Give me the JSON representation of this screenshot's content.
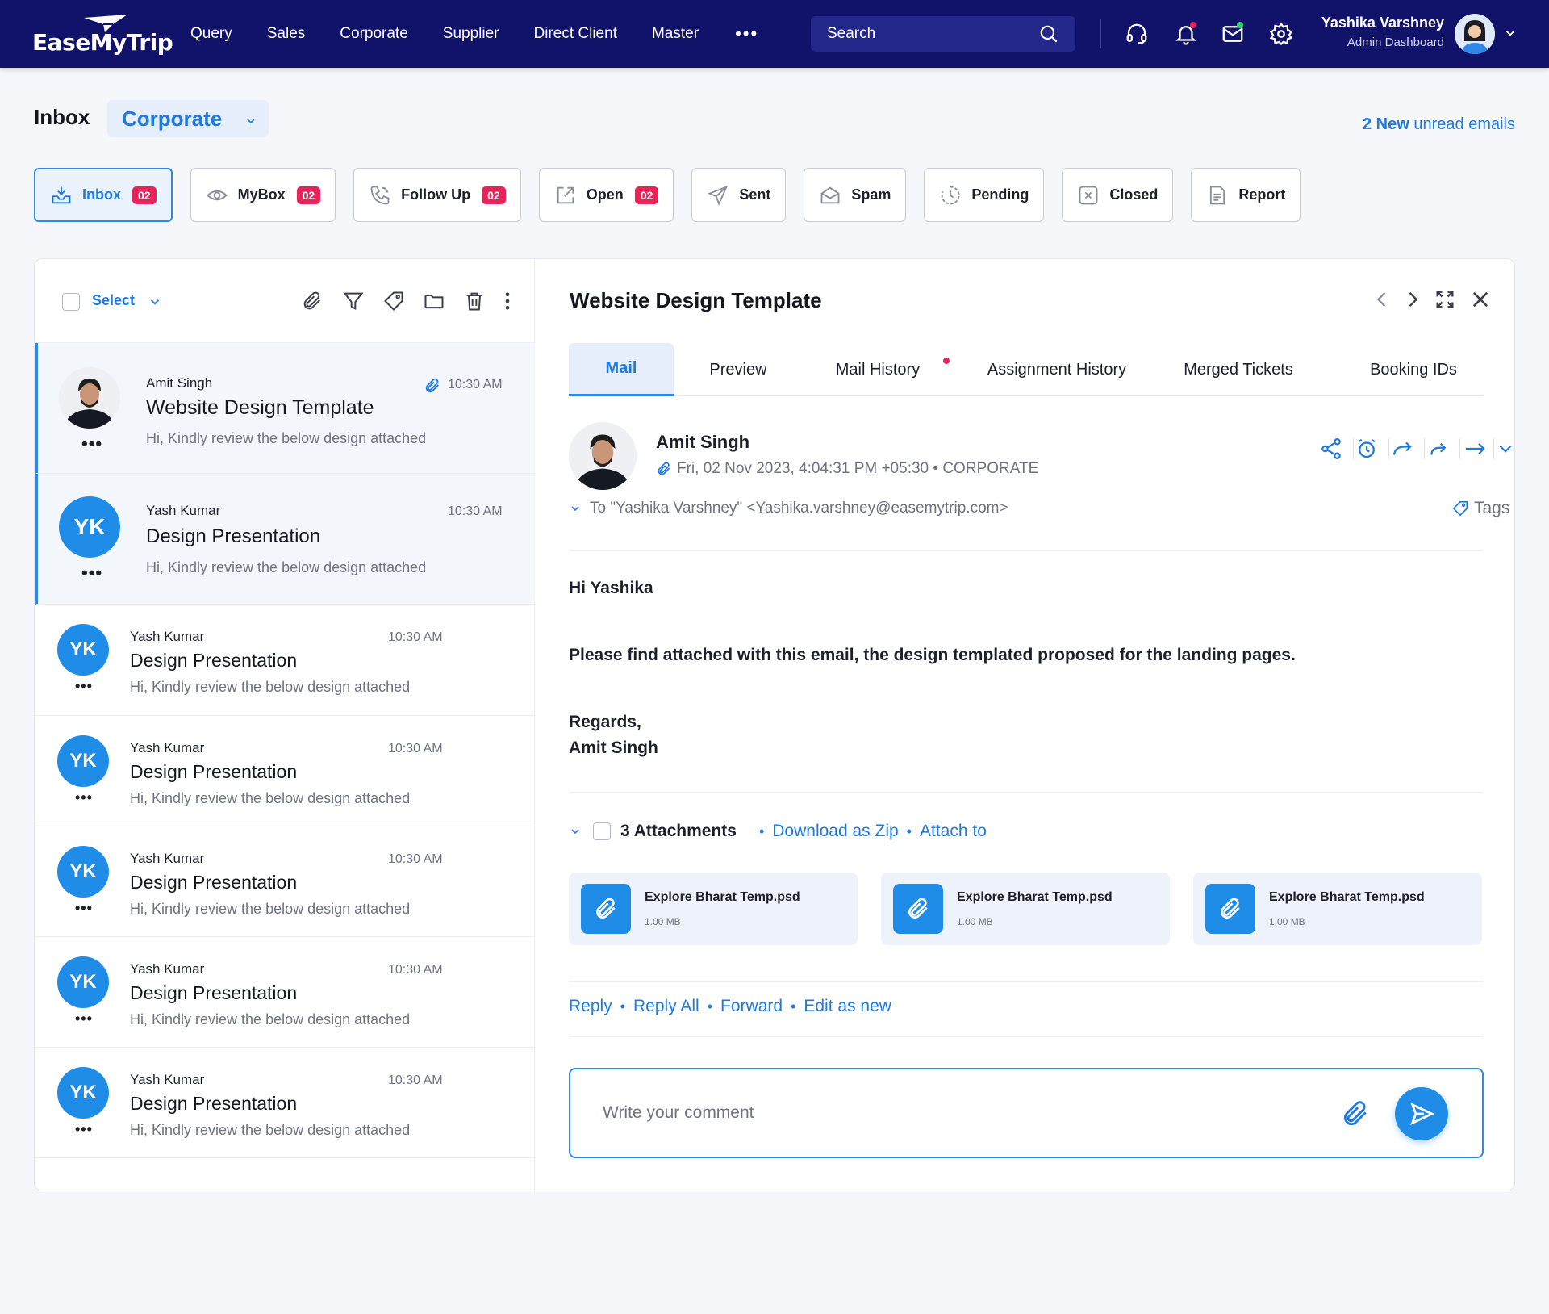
{
  "app": {
    "logo_text": "EaseMyTrip"
  },
  "nav": {
    "items": [
      "Query",
      "Sales",
      "Corporate",
      "Supplier",
      "Direct Client",
      "Master"
    ],
    "more": "•••"
  },
  "search": {
    "placeholder": "Search"
  },
  "user": {
    "name": "Yashika Varshney",
    "role": "Admin Dashboard"
  },
  "header": {
    "title": "Inbox",
    "folder": "Corporate",
    "unread_count": "2 New",
    "unread_text": "unread emails"
  },
  "folder_tabs": [
    {
      "label": "Inbox",
      "badge": "02",
      "icon": "inbox-icon"
    },
    {
      "label": "MyBox",
      "badge": "02",
      "icon": "eye-icon"
    },
    {
      "label": "Follow Up",
      "badge": "02",
      "icon": "phone-icon"
    },
    {
      "label": "Open",
      "badge": "02",
      "icon": "external-link-icon"
    },
    {
      "label": "Sent",
      "icon": "send-icon"
    },
    {
      "label": "Spam",
      "icon": "spam-icon"
    },
    {
      "label": "Pending",
      "icon": "clock-icon"
    },
    {
      "label": "Closed",
      "icon": "close-box-icon"
    },
    {
      "label": "Report",
      "icon": "document-icon"
    }
  ],
  "list": {
    "select_label": "Select",
    "emails": [
      {
        "from": "Amit Singh",
        "subject": "Website Design Template",
        "preview": "Hi, Kindly review the below design attached",
        "time": "10:30 AM",
        "has_attachment": true
      },
      {
        "from": "Yash Kumar",
        "initials": "YK",
        "subject": "Design Presentation",
        "preview": "Hi, Kindly review the below design attached",
        "time": "10:30 AM"
      },
      {
        "from": "Yash Kumar",
        "initials": "YK",
        "subject": "Design Presentation",
        "preview": "Hi, Kindly review the below design attached",
        "time": "10:30 AM"
      },
      {
        "from": "Yash Kumar",
        "initials": "YK",
        "subject": "Design Presentation",
        "preview": "Hi, Kindly review the below design attached",
        "time": "10:30 AM"
      },
      {
        "from": "Yash Kumar",
        "initials": "YK",
        "subject": "Design Presentation",
        "preview": "Hi, Kindly review the below design attached",
        "time": "10:30 AM"
      },
      {
        "from": "Yash Kumar",
        "initials": "YK",
        "subject": "Design Presentation",
        "preview": "Hi, Kindly review the below design attached",
        "time": "10:30 AM"
      },
      {
        "from": "Yash Kumar",
        "initials": "YK",
        "subject": "Design Presentation",
        "preview": "Hi, Kindly review the below design attached",
        "time": "10:30 AM"
      }
    ]
  },
  "detail": {
    "title": "Website Design Template",
    "tabs": [
      "Mail",
      "Preview",
      "Mail History",
      "Assignment History",
      "Merged Tickets",
      "Booking IDs"
    ],
    "sender": {
      "name": "Amit Singh",
      "meta": "Fri, 02 Nov 2023, 4:04:31 PM +05:30 • CORPORATE"
    },
    "to": "To \"Yashika Varshney\" <Yashika.varshney@easemytrip.com>",
    "tags_label": "Tags",
    "body": {
      "greeting": "Hi Yashika",
      "line1": "Please find attached with this email, the design templated proposed for the landing pages.",
      "regards": "Regards,",
      "signature": "Amit Singh"
    },
    "attachments": {
      "count_label": "3 Attachments",
      "download_zip": "Download as Zip",
      "attach_to": "Attach to",
      "files": [
        {
          "name": "Explore Bharat Temp.psd",
          "size": "1.00 MB"
        },
        {
          "name": "Explore Bharat Temp.psd",
          "size": "1.00 MB"
        },
        {
          "name": "Explore Bharat Temp.psd",
          "size": "1.00 MB"
        }
      ]
    },
    "reply_actions": [
      "Reply",
      "Reply All",
      "Forward",
      "Edit as new"
    ],
    "comment_placeholder": "Write your comment"
  },
  "colors": {
    "nav_bg": "#11136b",
    "accent": "#1f7ae0",
    "badge": "#e8235a",
    "avatar": "#1f8de8"
  }
}
